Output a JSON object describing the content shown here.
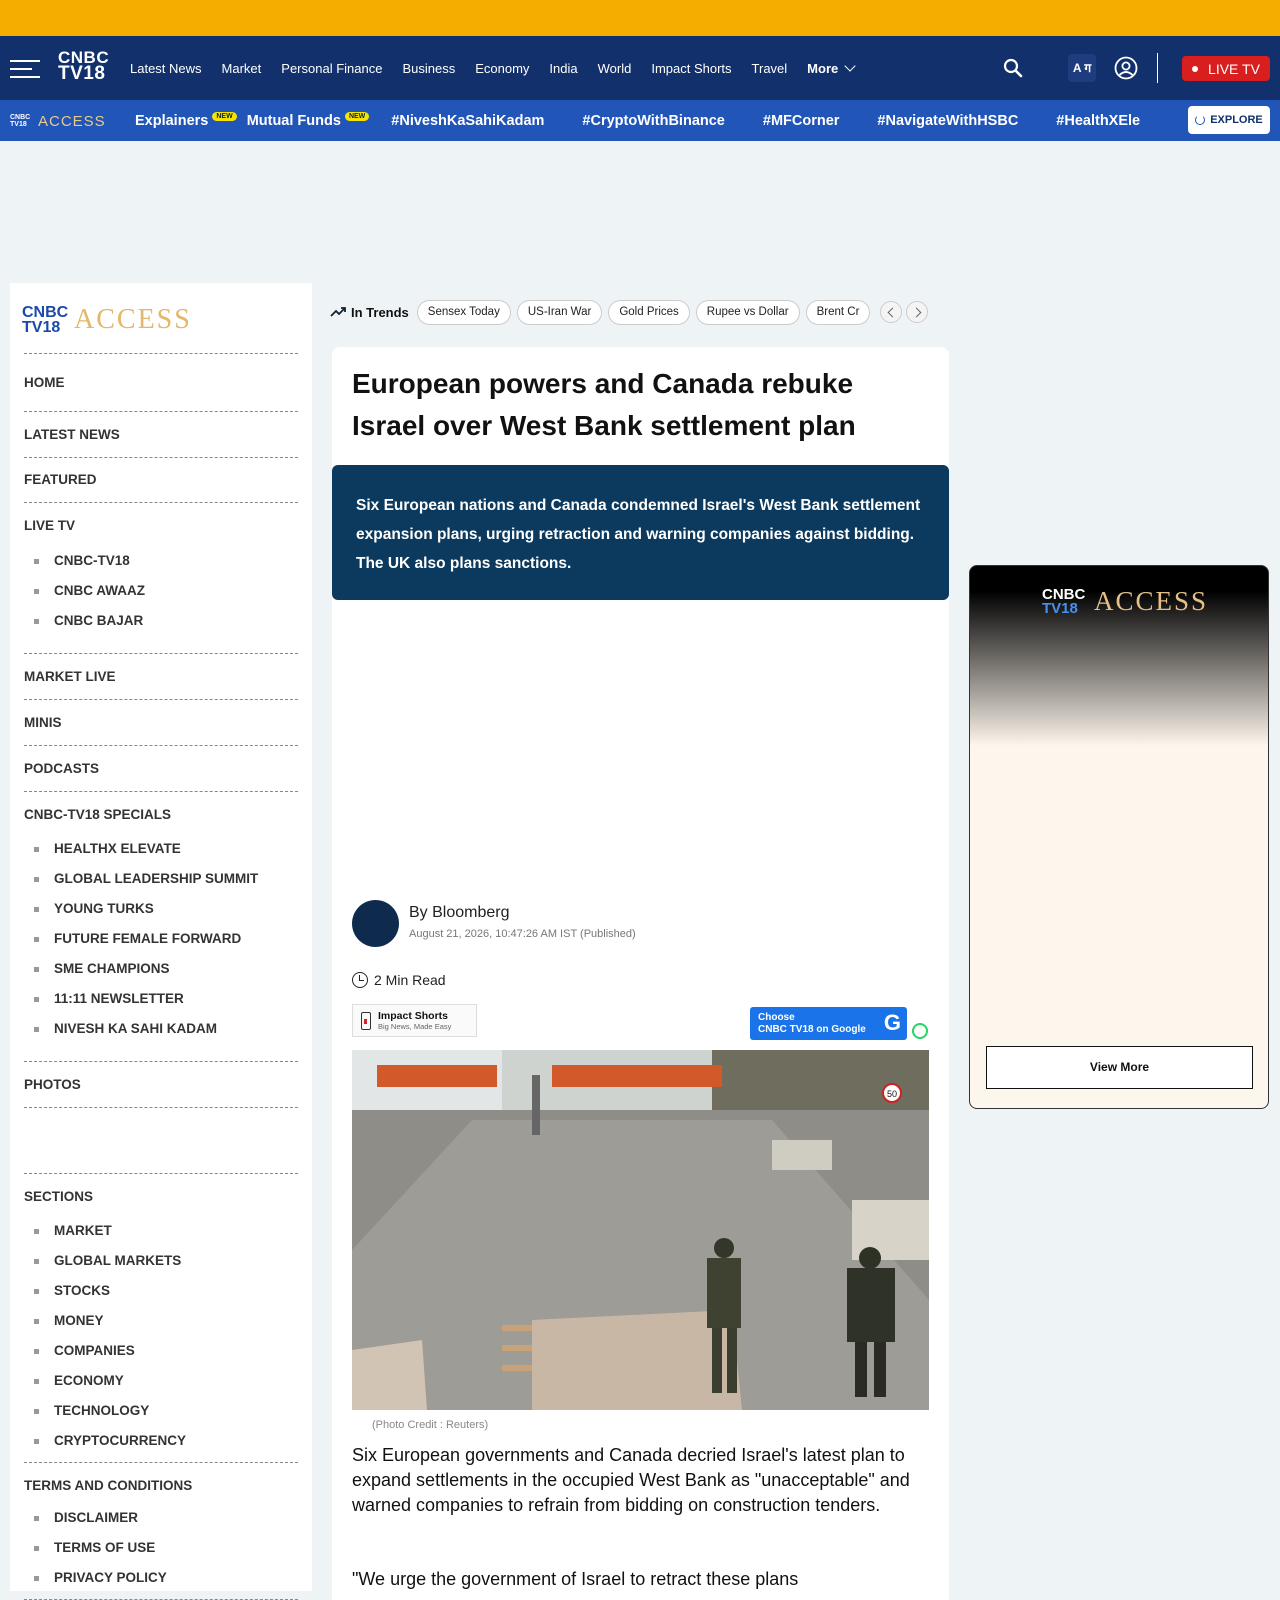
{
  "nav": {
    "logo_line1": "CNBC",
    "logo_line2": "TV18",
    "links": [
      "Latest News",
      "Market",
      "Personal Finance",
      "Business",
      "Economy",
      "India",
      "World",
      "Impact Shorts",
      "Travel"
    ],
    "more_label": "More",
    "lang_label": "A ग",
    "live_tv_label": "LIVE TV"
  },
  "subnav": {
    "logo_mini": "CNBC TV18",
    "logo_access": "ACCESS",
    "items": [
      {
        "label": "Explainers",
        "badge": "NEW"
      },
      {
        "label": "Mutual Funds",
        "badge": "NEW"
      },
      {
        "label": "#NiveshKaSahiKadam",
        "badge": ""
      },
      {
        "label": "#CryptoWithBinance",
        "badge": ""
      },
      {
        "label": "#MFCorner",
        "badge": ""
      },
      {
        "label": "#NavigateWithHSBC",
        "badge": ""
      },
      {
        "label": "#HealthXEle",
        "badge": ""
      }
    ],
    "explore_label": "EXPLORE"
  },
  "sidebar": {
    "logo_line1": "CNBC",
    "logo_line2": "TV18",
    "logo_access": "ACCESS",
    "home": "HOME",
    "latest_news": "LATEST NEWS",
    "featured": "FEATURED",
    "live_tv": "LIVE TV",
    "live_tv_items": [
      "CNBC-TV18",
      "CNBC AWAAZ",
      "CNBC BAJAR"
    ],
    "market_live": "MARKET LIVE",
    "minis": "MINIS",
    "podcasts": "PODCASTS",
    "specials": "CNBC-TV18 SPECIALS",
    "specials_items": [
      "HEALTHX ELEVATE",
      "GLOBAL LEADERSHIP SUMMIT",
      "YOUNG TURKS",
      "FUTURE FEMALE FORWARD",
      "SME CHAMPIONS",
      "11:11 NEWSLETTER",
      "NIVESH KA SAHI KADAM"
    ],
    "photos": "PHOTOS",
    "sections": "SECTIONS",
    "sections_items": [
      "MARKET",
      "GLOBAL MARKETS",
      "STOCKS",
      "MONEY",
      "COMPANIES",
      "ECONOMY",
      "TECHNOLOGY",
      "CRYPTOCURRENCY"
    ],
    "terms": "TERMS AND CONDITIONS",
    "terms_items": [
      "DISCLAIMER",
      "TERMS OF USE",
      "PRIVACY POLICY"
    ]
  },
  "trends": {
    "label": "In Trends",
    "chips": [
      "Sensex Today",
      "US-Iran War",
      "Gold Prices",
      "Rupee vs Dollar",
      "Brent Cr"
    ]
  },
  "article": {
    "headline": "European powers and Canada rebuke Israel over West Bank settlement plan",
    "summary": "Six European nations and Canada condemned Israel's West Bank settlement expansion plans, urging retraction and warning companies against bidding. The UK also plans sanctions.",
    "author": "By Bloomberg",
    "date": "August 21, 2026, 10:47:26 AM IST (Published)",
    "read_time": "2 Min Read",
    "impact_title": "Impact Shorts",
    "impact_sub": "Big News, Made Easy",
    "google_line1": "Choose",
    "google_line2": "CNBC TV18 on Google",
    "photo_credit": "(Photo Credit : Reuters)",
    "photo_sign": "50",
    "body1": "Six European governments and Canada decried Israel's latest plan to expand settlements in the occupied West Bank as \"unacceptable\" and warned companies to refrain from bidding on construction tenders.",
    "body2": "\"We urge the government of Israel to retract these plans"
  },
  "right_ad": {
    "logo_line1": "CNBC",
    "logo_line2": "TV18",
    "logo_access": "ACCESS",
    "view_more": "View More"
  },
  "colors": {
    "topbar": "#f5ae00",
    "nav_bg": "#12306b",
    "subnav_bg": "#2155b8",
    "live_red": "#d81e1e",
    "summary_bg": "#0c3a5e"
  }
}
